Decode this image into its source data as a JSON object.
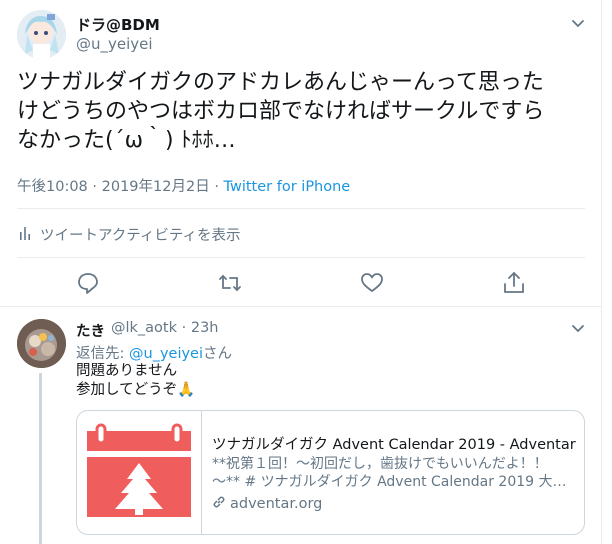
{
  "tweet": {
    "display_name": "ドラ@BDM",
    "handle": "@u_yeiyei",
    "text_lines": [
      "ツナガルダイガクのアドカレあんじゃーんって思った",
      "けどうちのやつはボカロ部でなければサークルですら",
      "なかった(´ω｀) ﾄﾎﾎ…"
    ],
    "time": "午後10:08",
    "date": "2019年12月2日",
    "dot": "·",
    "client": "Twitter for iPhone",
    "activity_label": "ツイートアクティビティを表示",
    "icons": {
      "caret": "chevron-down-icon",
      "activity": "bar-chart-icon",
      "reply": "reply-icon",
      "retweet": "retweet-icon",
      "like": "heart-icon",
      "share": "share-icon"
    }
  },
  "reply": {
    "display_name": "たき",
    "handle": "@lk_aotk",
    "dot": "·",
    "time": "23h",
    "reply_prefix": "返信先: ",
    "reply_mention": "@u_yeiyei",
    "reply_suffix": "さん",
    "text_line1": "問題ありません",
    "text_line2": "参加してどうぞ🙏",
    "card": {
      "title": "ツナガルダイガク Advent Calendar 2019 - Adventar",
      "desc_line1": "**祝第１回！〜初回だし，歯抜けでもいいんだよ！！",
      "desc_line2": "〜** # ツナガルダイガク Advent Calendar 2019 大…",
      "url": "adventar.org"
    }
  },
  "colors": {
    "accent": "#1b95e0",
    "muted": "#657786",
    "card_red": "#f05d5d"
  }
}
